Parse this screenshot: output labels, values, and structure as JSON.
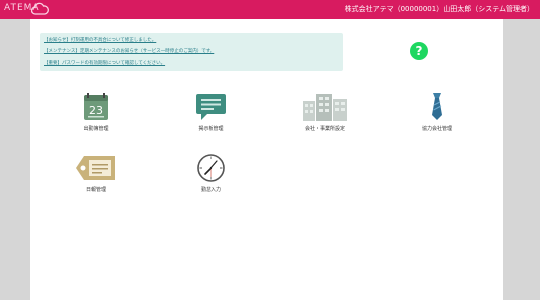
{
  "header": {
    "brand": "ATEMA",
    "user_info": "株式会社アテマ（00000001）山田太郎（システム管理者）"
  },
  "notices": [
    "【お知らせ】打刻運用の不具合について修正しました。",
    "【メンテナンス】定期メンテナンスのお知らせ（サービス一時停止のご案内）です。",
    "【重要】パスワードの有効期限について確認してください。"
  ],
  "help": {
    "label": "?"
  },
  "menu": [
    {
      "label": "出勤簿管理",
      "icon": "calendar-icon"
    },
    {
      "label": "掲示板管理",
      "icon": "chat-bubble-icon"
    },
    {
      "label": "会社・事業所設定",
      "icon": "office-buildings-icon"
    },
    {
      "label": "協力会社管理",
      "icon": "necktie-icon"
    },
    {
      "label": "日報管理",
      "icon": "name-tag-icon"
    },
    {
      "label": "勤怠入力",
      "icon": "clock-icon"
    }
  ],
  "calendar_day": "23",
  "colors": {
    "topbar": "#d81b60",
    "help": "#1ed760",
    "notice_bg": "#dff1ee"
  }
}
